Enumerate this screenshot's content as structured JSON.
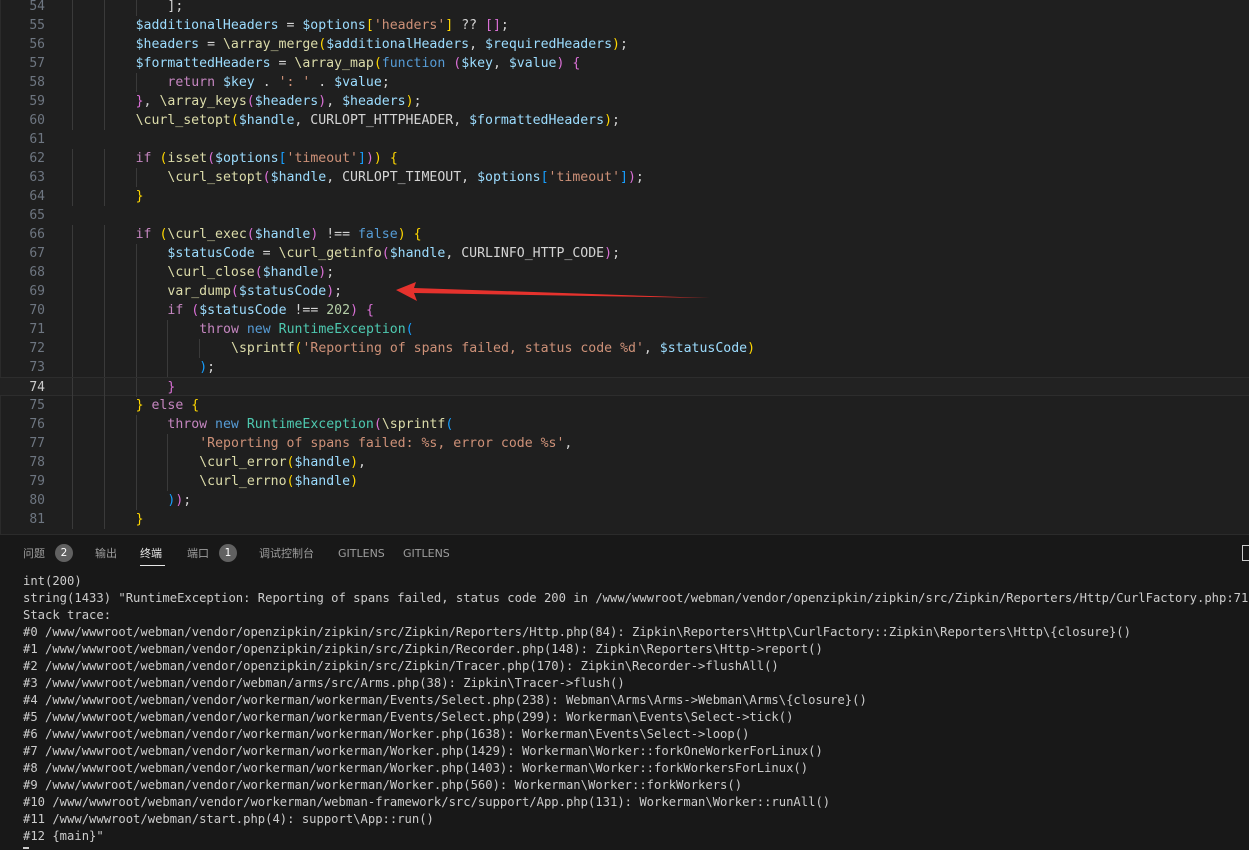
{
  "editor": {
    "active_line": "74",
    "lines": [
      {
        "n": "54",
        "indent": 3,
        "tokens": [
          [
            "p",
            "];"
          ]
        ]
      },
      {
        "n": "55",
        "indent": 2,
        "tokens": [
          [
            "v",
            "$additionalHeaders"
          ],
          [
            "p",
            " = "
          ],
          [
            "v",
            "$options"
          ],
          [
            "y",
            "["
          ],
          [
            "s",
            "'headers'"
          ],
          [
            "y",
            "]"
          ],
          [
            "p",
            " ?? "
          ],
          [
            "m",
            "[]"
          ],
          [
            "p",
            ";"
          ]
        ]
      },
      {
        "n": "56",
        "indent": 2,
        "tokens": [
          [
            "v",
            "$headers"
          ],
          [
            "p",
            " = "
          ],
          [
            "f",
            "\\array_merge"
          ],
          [
            "y",
            "("
          ],
          [
            "v",
            "$additionalHeaders"
          ],
          [
            "p",
            ", "
          ],
          [
            "v",
            "$requiredHeaders"
          ],
          [
            "y",
            ")"
          ],
          [
            "p",
            ";"
          ]
        ]
      },
      {
        "n": "57",
        "indent": 2,
        "tokens": [
          [
            "v",
            "$formattedHeaders"
          ],
          [
            "p",
            " = "
          ],
          [
            "f",
            "\\array_map"
          ],
          [
            "y",
            "("
          ],
          [
            "k",
            "function"
          ],
          [
            "p",
            " "
          ],
          [
            "m",
            "("
          ],
          [
            "v",
            "$key"
          ],
          [
            "p",
            ", "
          ],
          [
            "v",
            "$value"
          ],
          [
            "m",
            ")"
          ],
          [
            "p",
            " "
          ],
          [
            "m",
            "{"
          ]
        ]
      },
      {
        "n": "58",
        "indent": 3,
        "tokens": [
          [
            "c",
            "return"
          ],
          [
            "p",
            " "
          ],
          [
            "v",
            "$key"
          ],
          [
            "p",
            " . "
          ],
          [
            "s",
            "': '"
          ],
          [
            "p",
            " . "
          ],
          [
            "v",
            "$value"
          ],
          [
            "p",
            ";"
          ]
        ]
      },
      {
        "n": "59",
        "indent": 2,
        "tokens": [
          [
            "m",
            "}"
          ],
          [
            "p",
            ", "
          ],
          [
            "f",
            "\\array_keys"
          ],
          [
            "m",
            "("
          ],
          [
            "v",
            "$headers"
          ],
          [
            "m",
            ")"
          ],
          [
            "p",
            ", "
          ],
          [
            "v",
            "$headers"
          ],
          [
            "y",
            ")"
          ],
          [
            "p",
            ";"
          ]
        ]
      },
      {
        "n": "60",
        "indent": 2,
        "tokens": [
          [
            "f",
            "\\curl_setopt"
          ],
          [
            "y",
            "("
          ],
          [
            "v",
            "$handle"
          ],
          [
            "p",
            ", CURLOPT_HTTPHEADER, "
          ],
          [
            "v",
            "$formattedHeaders"
          ],
          [
            "y",
            ")"
          ],
          [
            "p",
            ";"
          ]
        ]
      },
      {
        "n": "61",
        "indent": 0,
        "tokens": []
      },
      {
        "n": "62",
        "indent": 2,
        "tokens": [
          [
            "c",
            "if"
          ],
          [
            "p",
            " "
          ],
          [
            "y",
            "("
          ],
          [
            "f",
            "isset"
          ],
          [
            "m",
            "("
          ],
          [
            "v",
            "$options"
          ],
          [
            "b",
            "["
          ],
          [
            "s",
            "'timeout'"
          ],
          [
            "b",
            "]"
          ],
          [
            "m",
            ")"
          ],
          [
            "y",
            ")"
          ],
          [
            "p",
            " "
          ],
          [
            "y",
            "{"
          ]
        ]
      },
      {
        "n": "63",
        "indent": 3,
        "tokens": [
          [
            "f",
            "\\curl_setopt"
          ],
          [
            "m",
            "("
          ],
          [
            "v",
            "$handle"
          ],
          [
            "p",
            ", CURLOPT_TIMEOUT, "
          ],
          [
            "v",
            "$options"
          ],
          [
            "b",
            "["
          ],
          [
            "s",
            "'timeout'"
          ],
          [
            "b",
            "]"
          ],
          [
            "m",
            ")"
          ],
          [
            "p",
            ";"
          ]
        ]
      },
      {
        "n": "64",
        "indent": 2,
        "tokens": [
          [
            "y",
            "}"
          ]
        ]
      },
      {
        "n": "65",
        "indent": 0,
        "tokens": []
      },
      {
        "n": "66",
        "indent": 2,
        "tokens": [
          [
            "c",
            "if"
          ],
          [
            "p",
            " "
          ],
          [
            "y",
            "("
          ],
          [
            "f",
            "\\curl_exec"
          ],
          [
            "m",
            "("
          ],
          [
            "v",
            "$handle"
          ],
          [
            "m",
            ")"
          ],
          [
            "p",
            " !== "
          ],
          [
            "k",
            "false"
          ],
          [
            "y",
            ")"
          ],
          [
            "p",
            " "
          ],
          [
            "y",
            "{"
          ]
        ]
      },
      {
        "n": "67",
        "indent": 3,
        "tokens": [
          [
            "v",
            "$statusCode"
          ],
          [
            "p",
            " = "
          ],
          [
            "f",
            "\\curl_getinfo"
          ],
          [
            "m",
            "("
          ],
          [
            "v",
            "$handle"
          ],
          [
            "p",
            ", CURLINFO_HTTP_CODE"
          ],
          [
            "m",
            ")"
          ],
          [
            "p",
            ";"
          ]
        ]
      },
      {
        "n": "68",
        "indent": 3,
        "tokens": [
          [
            "f",
            "\\curl_close"
          ],
          [
            "m",
            "("
          ],
          [
            "v",
            "$handle"
          ],
          [
            "m",
            ")"
          ],
          [
            "p",
            ";"
          ]
        ]
      },
      {
        "n": "69",
        "indent": 3,
        "tokens": [
          [
            "f",
            "var_dump"
          ],
          [
            "m",
            "("
          ],
          [
            "v",
            "$statusCode"
          ],
          [
            "m",
            ")"
          ],
          [
            "p",
            ";"
          ]
        ]
      },
      {
        "n": "70",
        "indent": 3,
        "tokens": [
          [
            "c",
            "if"
          ],
          [
            "p",
            " "
          ],
          [
            "m",
            "("
          ],
          [
            "v",
            "$statusCode"
          ],
          [
            "p",
            " !== "
          ],
          [
            "n",
            "202"
          ],
          [
            "m",
            ")"
          ],
          [
            "p",
            " "
          ],
          [
            "m",
            "{"
          ]
        ]
      },
      {
        "n": "71",
        "indent": 4,
        "tokens": [
          [
            "c",
            "throw"
          ],
          [
            "p",
            " "
          ],
          [
            "k",
            "new"
          ],
          [
            "p",
            " "
          ],
          [
            "t",
            "RuntimeException"
          ],
          [
            "b",
            "("
          ]
        ]
      },
      {
        "n": "72",
        "indent": 5,
        "tokens": [
          [
            "f",
            "\\sprintf"
          ],
          [
            "y",
            "("
          ],
          [
            "s",
            "'Reporting of spans failed, status code %d'"
          ],
          [
            "p",
            ", "
          ],
          [
            "v",
            "$statusCode"
          ],
          [
            "y",
            ")"
          ]
        ]
      },
      {
        "n": "73",
        "indent": 4,
        "tokens": [
          [
            "b",
            ")"
          ],
          [
            "p",
            ";"
          ]
        ]
      },
      {
        "n": "74",
        "indent": 3,
        "tokens": [
          [
            "m",
            "}"
          ]
        ]
      },
      {
        "n": "75",
        "indent": 2,
        "tokens": [
          [
            "y",
            "}"
          ],
          [
            "p",
            " "
          ],
          [
            "c",
            "else"
          ],
          [
            "p",
            " "
          ],
          [
            "y",
            "{"
          ]
        ]
      },
      {
        "n": "76",
        "indent": 3,
        "tokens": [
          [
            "c",
            "throw"
          ],
          [
            "p",
            " "
          ],
          [
            "k",
            "new"
          ],
          [
            "p",
            " "
          ],
          [
            "t",
            "RuntimeException"
          ],
          [
            "m",
            "("
          ],
          [
            "f",
            "\\sprintf"
          ],
          [
            "b",
            "("
          ]
        ]
      },
      {
        "n": "77",
        "indent": 4,
        "tokens": [
          [
            "s",
            "'Reporting of spans failed: %s, error code %s'"
          ],
          [
            "p",
            ","
          ]
        ]
      },
      {
        "n": "78",
        "indent": 4,
        "tokens": [
          [
            "f",
            "\\curl_error"
          ],
          [
            "y",
            "("
          ],
          [
            "v",
            "$handle"
          ],
          [
            "y",
            ")"
          ],
          [
            "p",
            ","
          ]
        ]
      },
      {
        "n": "79",
        "indent": 4,
        "tokens": [
          [
            "f",
            "\\curl_errno"
          ],
          [
            "y",
            "("
          ],
          [
            "v",
            "$handle"
          ],
          [
            "y",
            ")"
          ]
        ]
      },
      {
        "n": "80",
        "indent": 3,
        "tokens": [
          [
            "b",
            ")"
          ],
          [
            "m",
            ")"
          ],
          [
            "p",
            ";"
          ]
        ]
      },
      {
        "n": "81",
        "indent": 2,
        "tokens": [
          [
            "y",
            "}"
          ]
        ]
      }
    ]
  },
  "annotation": {
    "color": "#e5322d"
  },
  "panel": {
    "tabs": [
      {
        "label": "问题",
        "badge": "2"
      },
      {
        "label": "输出",
        "badge": ""
      },
      {
        "label": "终端",
        "badge": "",
        "active": true
      },
      {
        "label": "端口",
        "badge": "1"
      },
      {
        "label": "调试控制台",
        "badge": ""
      },
      {
        "label": "GITLENS",
        "badge": ""
      },
      {
        "label": "GITLENS",
        "badge": ""
      }
    ],
    "terminal_lines": [
      "int(200)",
      "string(1433) \"RuntimeException: Reporting of spans failed, status code 200 in /www/wwwroot/webman/vendor/openzipkin/zipkin/src/Zipkin/Reporters/Http/CurlFactory.php:71",
      "Stack trace:",
      "#0 /www/wwwroot/webman/vendor/openzipkin/zipkin/src/Zipkin/Reporters/Http.php(84): Zipkin\\Reporters\\Http\\CurlFactory::Zipkin\\Reporters\\Http\\{closure}()",
      "#1 /www/wwwroot/webman/vendor/openzipkin/zipkin/src/Zipkin/Recorder.php(148): Zipkin\\Reporters\\Http->report()",
      "#2 /www/wwwroot/webman/vendor/openzipkin/zipkin/src/Zipkin/Tracer.php(170): Zipkin\\Recorder->flushAll()",
      "#3 /www/wwwroot/webman/vendor/webman/arms/src/Arms.php(38): Zipkin\\Tracer->flush()",
      "#4 /www/wwwroot/webman/vendor/workerman/workerman/Events/Select.php(238): Webman\\Arms\\Arms->Webman\\Arms\\{closure}()",
      "#5 /www/wwwroot/webman/vendor/workerman/workerman/Events/Select.php(299): Workerman\\Events\\Select->tick()",
      "#6 /www/wwwroot/webman/vendor/workerman/workerman/Worker.php(1638): Workerman\\Events\\Select->loop()",
      "#7 /www/wwwroot/webman/vendor/workerman/workerman/Worker.php(1429): Workerman\\Worker::forkOneWorkerForLinux()",
      "#8 /www/wwwroot/webman/vendor/workerman/workerman/Worker.php(1403): Workerman\\Worker::forkWorkersForLinux()",
      "#9 /www/wwwroot/webman/vendor/workerman/workerman/Worker.php(560): Workerman\\Worker::forkWorkers()",
      "#10 /www/wwwroot/webman/vendor/workerman/webman-framework/src/support/App.php(131): Workerman\\Worker::runAll()",
      "#11 /www/wwwroot/webman/start.php(4): support\\App::run()",
      "#12 {main}\""
    ]
  }
}
